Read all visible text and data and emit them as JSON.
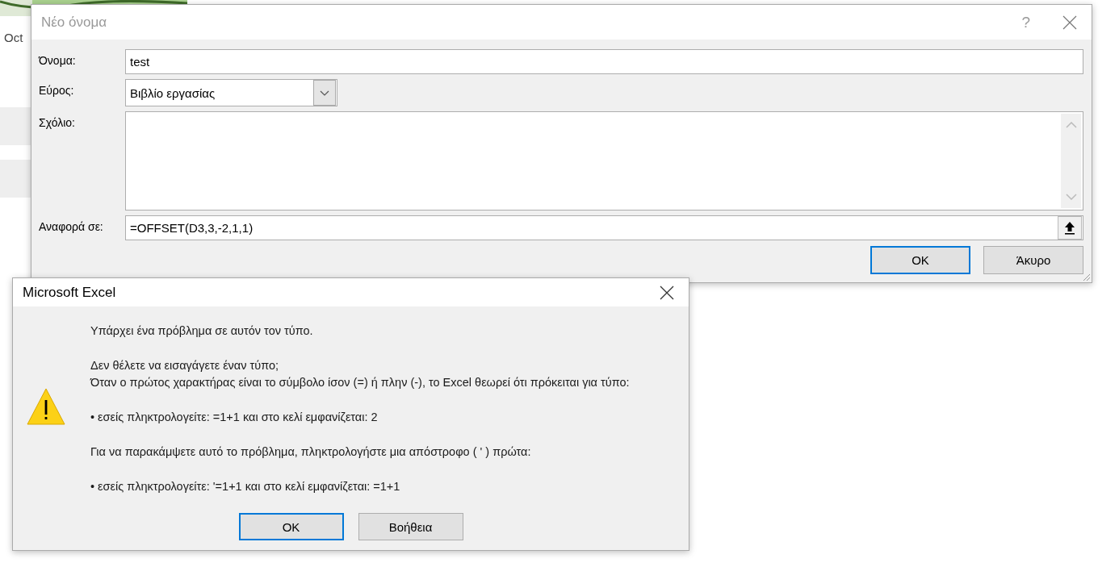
{
  "sheet": {
    "month_label": "Oct"
  },
  "name_dialog": {
    "title": "Νέο όνομα",
    "help": "?",
    "fields": [
      {
        "kind": "text",
        "label": "Όνομα:",
        "value": "test"
      },
      {
        "kind": "dropdown",
        "label": "Εύρος:",
        "value": "Βιβλίο εργασίας"
      },
      {
        "kind": "textarea",
        "label": "Σχόλιο:"
      },
      {
        "kind": "reference",
        "label": "Αναφορά σε:",
        "value": "=OFFSET(D3,3,-2,1,1)"
      }
    ],
    "buttons": [
      {
        "label": "OK",
        "default": true
      },
      {
        "label": "Άκυρο",
        "default": false
      }
    ]
  },
  "alert_dialog": {
    "title": "Microsoft Excel",
    "paragraphs": [
      {
        "lines": [
          "Υπάρχει ένα πρόβλημα σε αυτόν τον τύπο."
        ]
      },
      {
        "lines": [
          "Δεν θέλετε να εισαγάγετε έναν τύπο;",
          "Όταν ο πρώτος χαρακτήρας είναι το σύμβολο ίσον (=) ή πλην (-), το Excel θεωρεί ότι πρόκειται για τύπο:"
        ]
      },
      {
        "lines": [
          "• εσείς πληκτρολογείτε:  =1+1 και στο κελί εμφανίζεται:  2"
        ]
      },
      {
        "lines": [
          "Για να παρακάμψετε αυτό το πρόβλημα, πληκτρολογήστε μια απόστροφο ( ' ) πρώτα:"
        ]
      },
      {
        "lines": [
          "• εσείς πληκτρολογείτε:  '=1+1 και στο κελί εμφανίζεται:  =1+1"
        ]
      }
    ],
    "buttons": [
      {
        "label": "OK",
        "default": true
      },
      {
        "label": "Βοήθεια",
        "default": false
      }
    ]
  }
}
